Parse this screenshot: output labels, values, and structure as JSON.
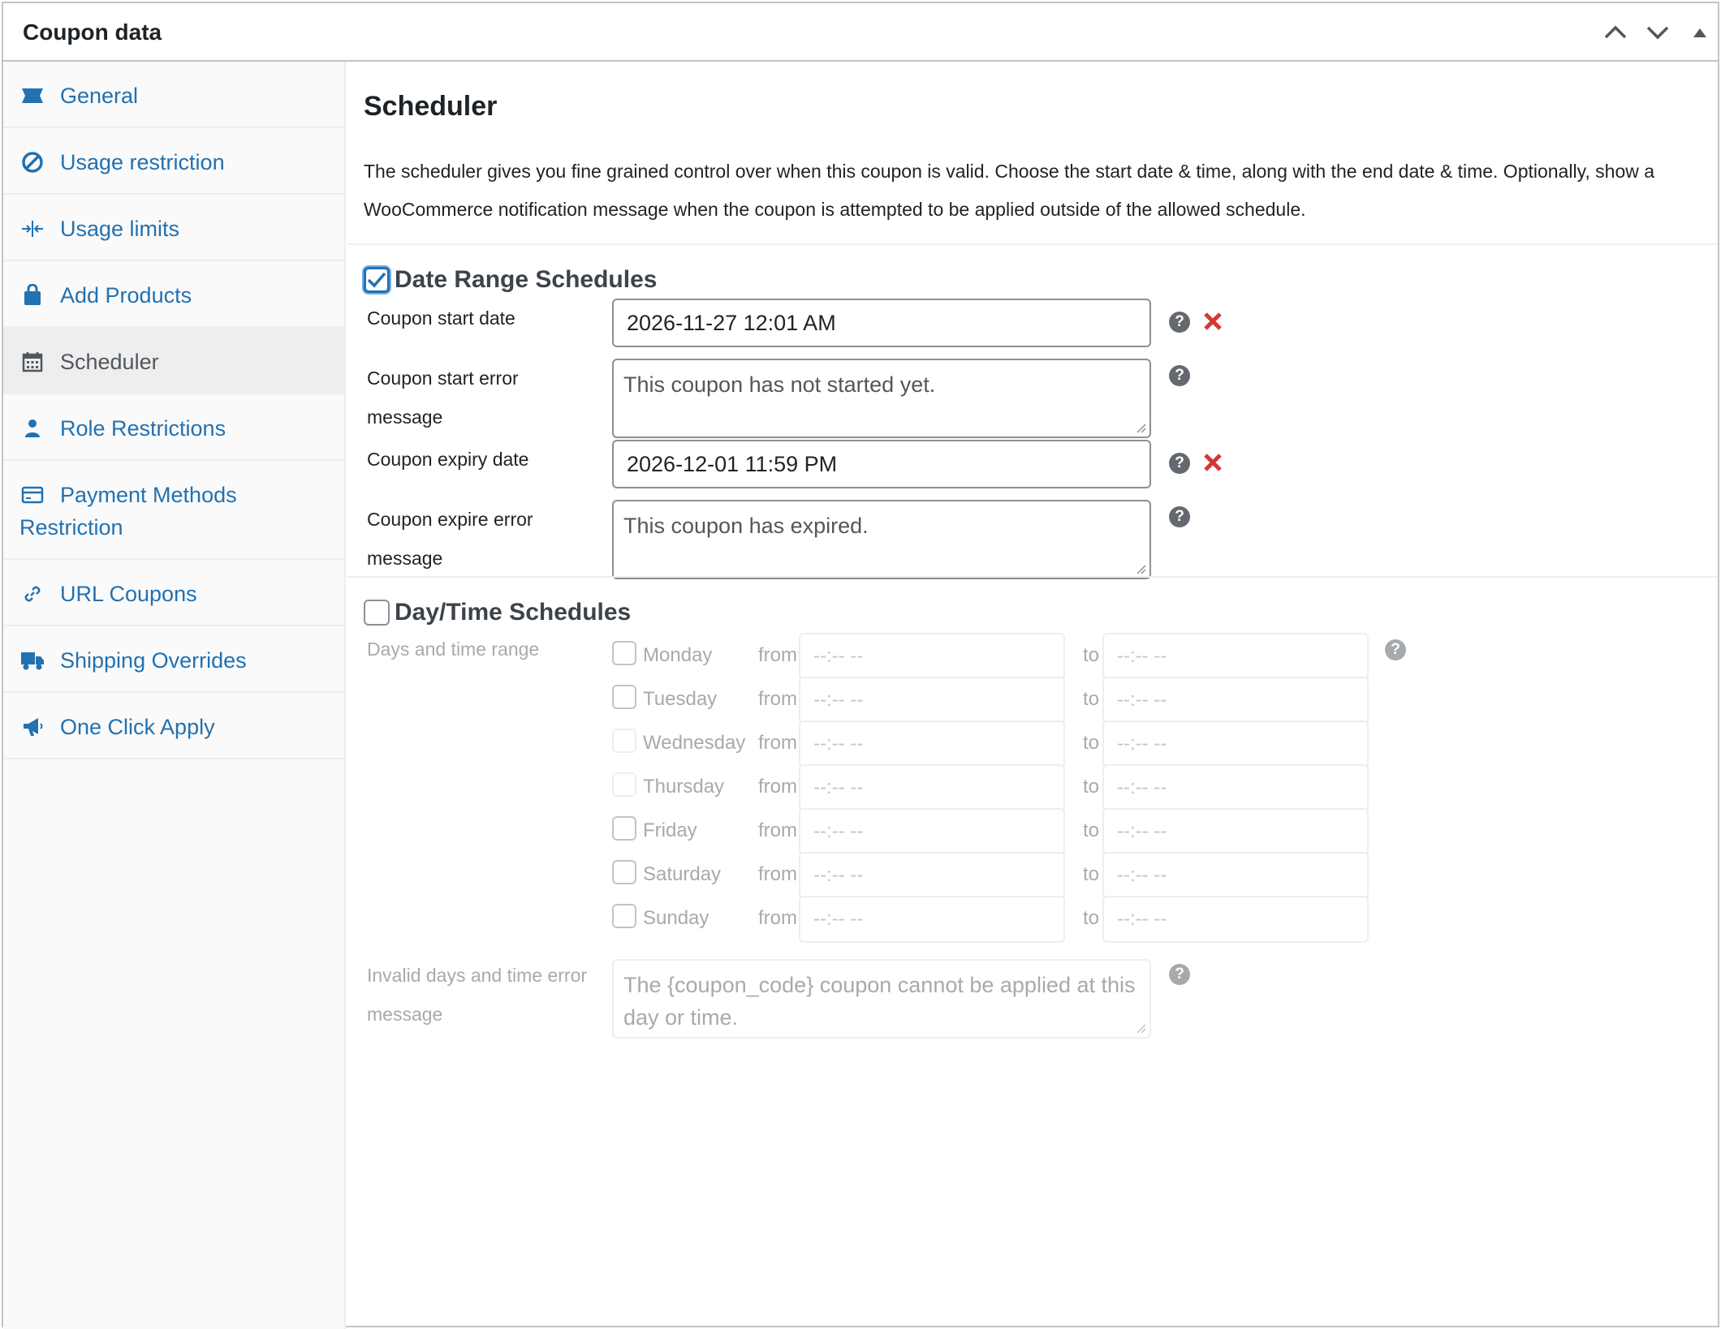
{
  "header": {
    "title": "Coupon data",
    "controls": [
      "chevron-up-icon",
      "chevron-down-icon",
      "triangle-up-icon"
    ]
  },
  "sidebar": {
    "items": [
      {
        "label": "General",
        "icon": "ticket-icon"
      },
      {
        "label": "Usage restriction",
        "icon": "block-icon"
      },
      {
        "label": "Usage limits",
        "icon": "split-arrows-icon"
      },
      {
        "label": "Add Products",
        "icon": "bag-icon"
      },
      {
        "label": "Scheduler",
        "icon": "calendar-icon",
        "active": true
      },
      {
        "label": "Role Restrictions",
        "icon": "user-icon"
      },
      {
        "label": "Payment Methods Restriction",
        "icon": "card-icon"
      },
      {
        "label": "URL Coupons",
        "icon": "link-icon"
      },
      {
        "label": "Shipping Overrides",
        "icon": "truck-icon"
      },
      {
        "label": "One Click Apply",
        "icon": "megaphone-icon"
      }
    ]
  },
  "scheduler": {
    "title": "Scheduler",
    "description": "The scheduler gives you fine grained control over when this coupon is valid. Choose the start date & time, along with the end date & time. Optionally, show a WooCommerce notification message when the coupon is attempted to be applied outside of the allowed schedule."
  },
  "date_range": {
    "heading": "Date Range Schedules",
    "checked": true,
    "start_date_label": "Coupon start date",
    "start_date_value": "2026-11-27 12:01 AM",
    "start_error_label": "Coupon start error message",
    "start_error_value": "This coupon has not started yet.",
    "expiry_date_label": "Coupon expiry date",
    "expiry_date_value": "2026-12-01 11:59 PM",
    "expire_error_label": "Coupon expire error message",
    "expire_error_value": "This coupon has expired."
  },
  "day_time": {
    "heading": "Day/Time Schedules",
    "checked": false,
    "range_label": "Days and time range",
    "from_label": "from",
    "to_label": "to",
    "time_placeholder": "--:-- --",
    "days": [
      "Monday",
      "Tuesday",
      "Wednesday",
      "Thursday",
      "Friday",
      "Saturday",
      "Sunday"
    ],
    "invalid_label": "Invalid days and time error message",
    "invalid_placeholder": "The {coupon_code} coupon cannot be applied at this day or time."
  },
  "colors": {
    "link": "#2271b1",
    "error_x": "#d63638",
    "border": "#c3c4c7"
  }
}
